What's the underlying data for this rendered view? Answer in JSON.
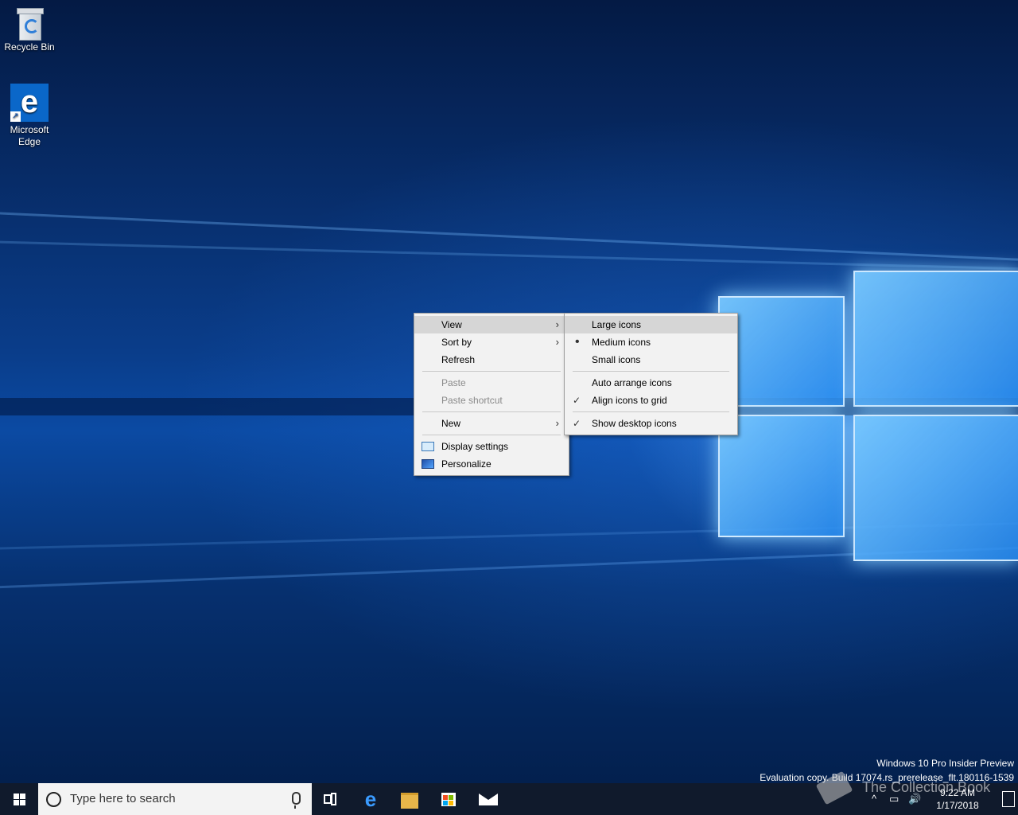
{
  "desktop_icons": [
    {
      "label": "Recycle Bin",
      "icon": "recycle-bin-icon"
    },
    {
      "label": "Microsoft\nEdge",
      "icon": "edge-icon"
    }
  ],
  "context_menu": {
    "items": [
      {
        "label": "View",
        "highlighted": true,
        "submenu": true
      },
      {
        "label": "Sort by",
        "submenu": true
      },
      {
        "label": "Refresh"
      },
      {
        "label": "Paste",
        "disabled": true
      },
      {
        "label": "Paste shortcut",
        "disabled": true
      },
      {
        "label": "New",
        "submenu": true
      },
      {
        "label": "Display settings",
        "icon": "display-icon"
      },
      {
        "label": "Personalize",
        "icon": "personalize-icon"
      }
    ],
    "arrow_glyph": "›"
  },
  "view_submenu": {
    "items": [
      {
        "label": "Large icons",
        "highlighted": true
      },
      {
        "label": "Medium icons",
        "mark": "•"
      },
      {
        "label": "Small icons"
      },
      {
        "label": "Auto arrange icons"
      },
      {
        "label": "Align icons to grid",
        "mark": "✓"
      },
      {
        "label": "Show desktop icons",
        "mark": "✓"
      }
    ]
  },
  "watermark": {
    "line1": "Windows 10 Pro Insider Preview",
    "line2": "Evaluation copy. Build 17074.rs_prerelease_flt.180116-1539"
  },
  "taskbar": {
    "search_placeholder": "Type here to search",
    "edge_glyph": "e",
    "tray": {
      "chevron": "^",
      "time": "9:22 AM",
      "date": "1/17/2018"
    }
  },
  "overlay_text": "The Collection Book",
  "colors": {
    "accent": "#0a67c9",
    "taskbar": "#101a2c",
    "menu_bg": "#f2f2f2",
    "menu_highlight": "#d6d6d6"
  }
}
